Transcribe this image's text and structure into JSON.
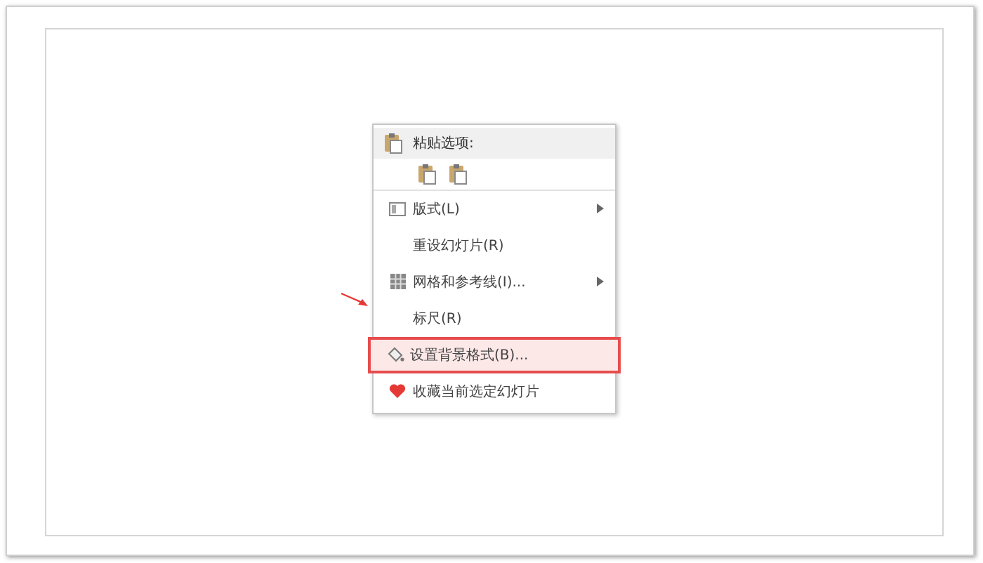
{
  "context_menu": {
    "items": [
      {
        "kind": "header",
        "label": "粘贴选项:"
      },
      {
        "kind": "paste-options"
      },
      {
        "kind": "item",
        "label": "版式(L)",
        "submenu": true,
        "highlighted": false
      },
      {
        "kind": "item",
        "label": "重设幻灯片(R)",
        "submenu": false,
        "highlighted": false
      },
      {
        "kind": "item",
        "label": "网格和参考线(I)...",
        "submenu": true,
        "highlighted": false
      },
      {
        "kind": "item",
        "label": "标尺(R)",
        "submenu": false,
        "highlighted": false
      },
      {
        "kind": "item",
        "label": "设置背景格式(B)...",
        "submenu": false,
        "highlighted": true
      },
      {
        "kind": "item",
        "label": "收藏当前选定幻灯片",
        "submenu": false,
        "highlighted": false
      }
    ]
  }
}
